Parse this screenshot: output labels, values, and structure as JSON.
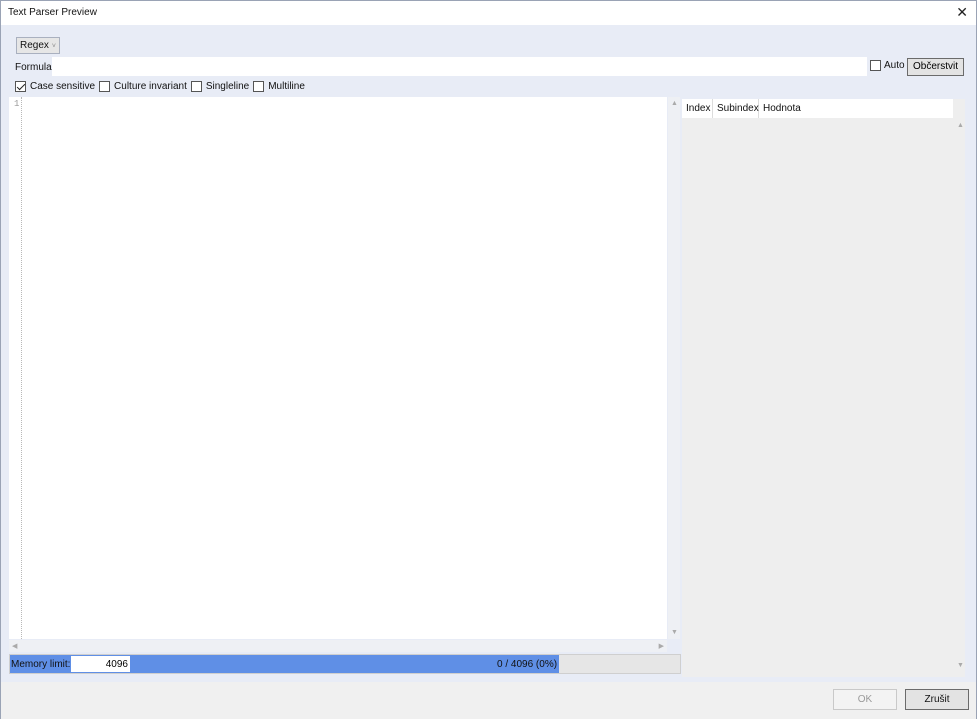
{
  "window": {
    "title": "Text Parser Preview"
  },
  "mode": {
    "selected": "Regex"
  },
  "formula": {
    "label": "Formula:",
    "value": ""
  },
  "auto": {
    "label": "Auto",
    "checked": false
  },
  "refresh_label": "Občerstvit",
  "options": [
    {
      "label": "Case sensitive",
      "checked": true
    },
    {
      "label": "Culture invariant",
      "checked": false
    },
    {
      "label": "Singleline",
      "checked": false
    },
    {
      "label": "Multiline",
      "checked": false
    }
  ],
  "editor": {
    "line_numbers": [
      "1"
    ],
    "content": ""
  },
  "results": {
    "columns": [
      "Index",
      "Subindex",
      "Hodnota"
    ],
    "rows": []
  },
  "memory": {
    "label": "Memory limit:",
    "value": "4096",
    "usage_text": "0 / 4096 (0%)",
    "fill_fraction": 0.82
  },
  "footer": {
    "ok_label": "OK",
    "cancel_label": "Zrušit"
  },
  "colors": {
    "progress_fill": "#5f8fe6",
    "window_bg": "#e8ecf6"
  }
}
